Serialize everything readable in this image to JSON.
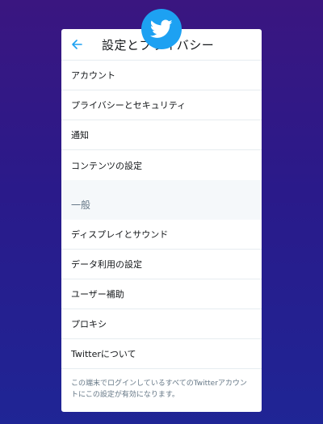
{
  "header": {
    "title": "設定とプライバシー"
  },
  "account_items": [
    {
      "label": "アカウント"
    },
    {
      "label": "プライバシーとセキュリティ"
    },
    {
      "label": "通知"
    },
    {
      "label": "コンテンツの設定"
    }
  ],
  "general": {
    "heading": "一般",
    "items": [
      {
        "label": "ディスプレイとサウンド"
      },
      {
        "label": "データ利用の設定"
      },
      {
        "label": "ユーザー補助"
      },
      {
        "label": "プロキシ"
      },
      {
        "label": "Twitterについて"
      }
    ]
  },
  "footer": {
    "text": "この端末でログインしているすべてのTwitterアカウントにこの設定が有効になります。"
  },
  "colors": {
    "brand": "#1da1f2",
    "background_top": "#3a1680",
    "background_bottom": "#1f2595"
  },
  "icons": {
    "app_badge": "twitter-bird-icon",
    "back": "arrow-left-icon"
  }
}
